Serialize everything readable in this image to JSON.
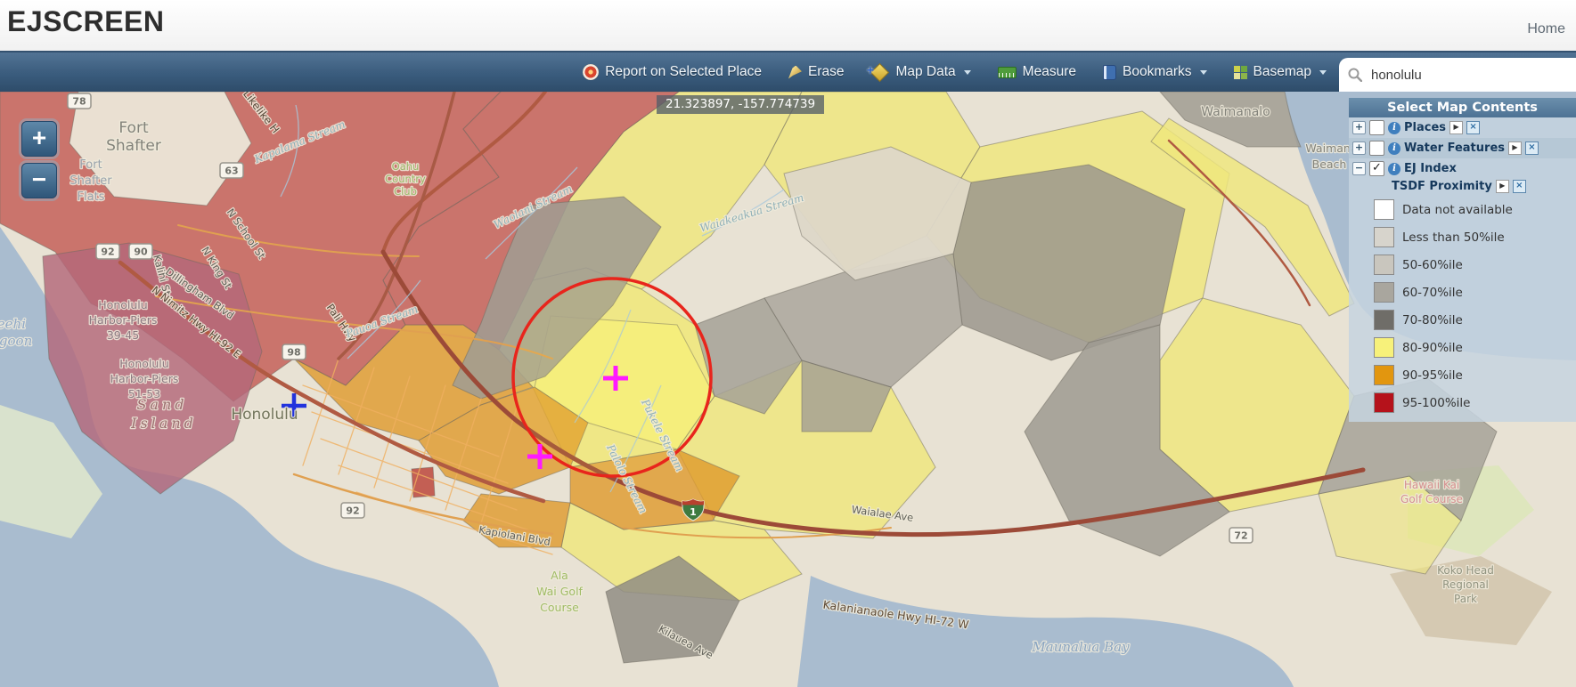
{
  "header": {
    "logo": "EJSCREEN",
    "home": "Home"
  },
  "toolbar": {
    "report": "Report on Selected Place",
    "erase": "Erase",
    "map_data": "Map Data",
    "measure": "Measure",
    "bookmarks": "Bookmarks",
    "basemap": "Basemap",
    "search_value": "honolulu"
  },
  "map": {
    "coordinates": "21.323897, -157.774739",
    "zoom_in": "+",
    "zoom_out": "−",
    "shields": {
      "s78": "78",
      "s63": "63",
      "s92a": "92",
      "s90": "90",
      "s98": "98",
      "s92b": "92",
      "s72": "72",
      "h1": "1"
    },
    "labels": {
      "fort_shafter_1": "Fort",
      "fort_shafter_2": "Shafter",
      "flats_1": "Fort",
      "flats_2": "Shafter",
      "flats_3": "Flats",
      "piers1_1": "Honolulu",
      "piers1_2": "Harbor-Piers",
      "piers1_3": "39-45",
      "piers2_1": "Honolulu",
      "piers2_2": "Harbor-Piers",
      "piers2_3": "51-53",
      "sand_1": "Sand",
      "sand_2": "Island",
      "honolulu": "Honolulu",
      "keehi_1": "Keehi",
      "keehi_2": "Lagoon",
      "oahu_1": "Oahu",
      "oahu_2": "Country",
      "oahu_3": "Club",
      "waimanalo": "Waimanalo",
      "waimanalo_b1": "Waimanalo",
      "waimanalo_b2": "Beach",
      "hawaii_kai_1": "Hawaii Kai",
      "hawaii_kai_2": "Golf Course",
      "koko_1": "Koko Head",
      "koko_2": "Regional",
      "koko_3": "Park",
      "maunalua": "Maunalua Bay",
      "ala_wai_1": "Ala",
      "ala_wai_2": "Wai Golf",
      "ala_wai_3": "Course",
      "kalanianaole": "Kalanianaole Hwy   HI-72 W",
      "likelike": "Likelike H",
      "school": "N School St",
      "kalihi": "Kalihi St",
      "king": "N King St",
      "dillingham": "Dillingham Blvd",
      "nimitz": "N Nimitz Hwy  HI-92 E",
      "pali": "Pali Hwy",
      "kapiolani": "Kapiolani Blvd",
      "kilauea": "Kilauea Ave",
      "waialae": "Waialae Ave",
      "kapalama": "Kapalama Stream",
      "waolani": "Waolani Stream",
      "pauoa": "Pauoa Stream",
      "waiakeakua": "Waiakeakua Stream",
      "palolo": "Palolo Stream",
      "pukele": "Pukele Stream"
    }
  },
  "panel": {
    "title": "Select Map Contents",
    "glyphs": {
      "expand": "▶",
      "close": "×",
      "info": "i"
    },
    "layers": [
      {
        "label": "Places",
        "expander": "+",
        "check": ""
      },
      {
        "label": "Water Features",
        "expander": "+",
        "check": ""
      },
      {
        "label": "EJ Index",
        "expander": "−",
        "check": "✓"
      }
    ],
    "sublayer": "TSDF Proximity",
    "legend": [
      {
        "label": "Data not available",
        "color": "#ffffff"
      },
      {
        "label": "Less than 50%ile",
        "color": "#d7d4cc"
      },
      {
        "label": "50-60%ile",
        "color": "#c9c6be"
      },
      {
        "label": "60-70%ile",
        "color": "#a9a69e"
      },
      {
        "label": "70-80%ile",
        "color": "#6f6d68"
      },
      {
        "label": "80-90%ile",
        "color": "#f7f17a"
      },
      {
        "label": "90-95%ile",
        "color": "#e2960f"
      },
      {
        "label": "95-100%ile",
        "color": "#b5121b"
      }
    ]
  }
}
